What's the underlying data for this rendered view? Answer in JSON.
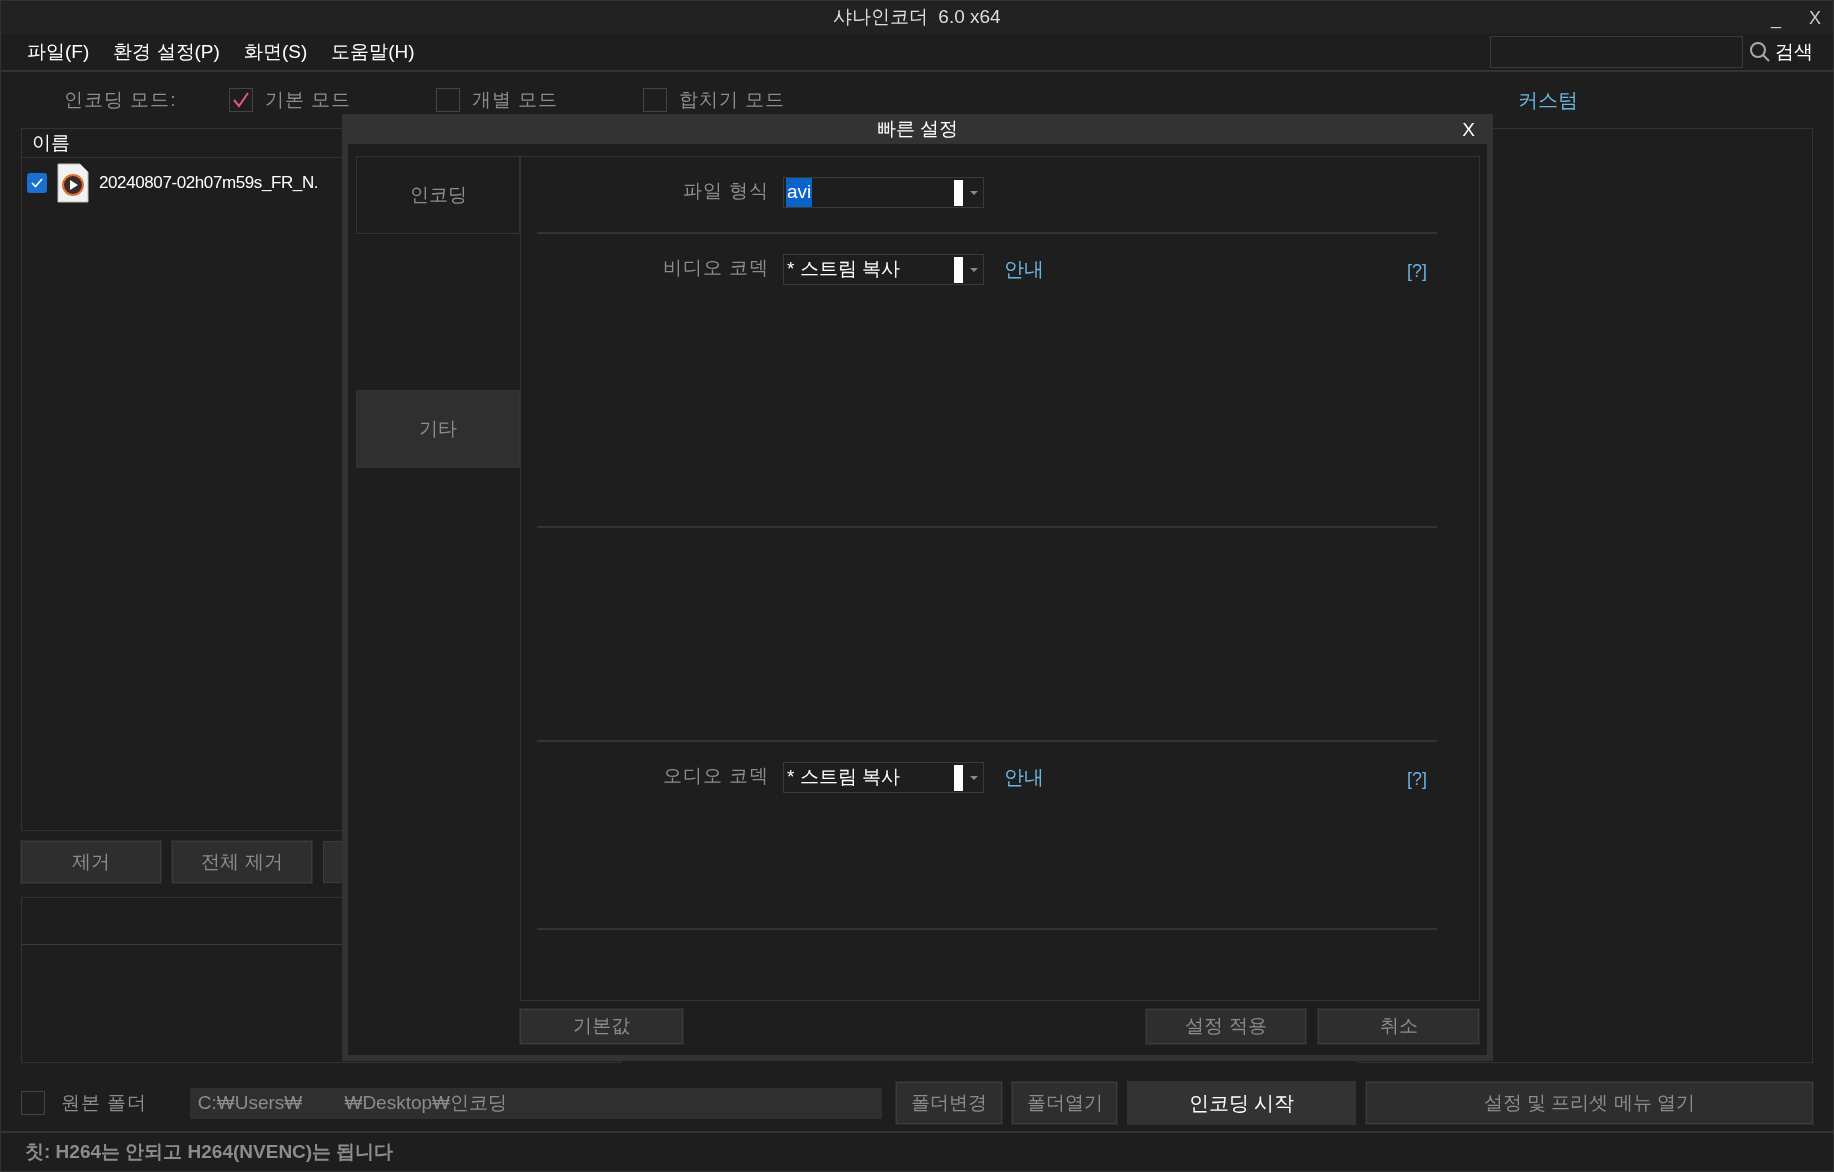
{
  "window": {
    "title": "샤나인코더",
    "version": "6.0 x64",
    "minimize": "_",
    "close": "X"
  },
  "menu": [
    "파일(F)",
    "환경 설정(P)",
    "화면(S)",
    "도움말(H)"
  ],
  "search": {
    "button": "검색"
  },
  "encoding_mode": {
    "label": "인코딩 모드:",
    "options": [
      {
        "label": "기본 모드",
        "checked": true
      },
      {
        "label": "개별 모드",
        "checked": false
      },
      {
        "label": "합치기 모드",
        "checked": false
      }
    ]
  },
  "custom_link": "커스텀",
  "file_list": {
    "column": "이름",
    "rows": [
      {
        "name": "20240807-02h07m59s_FR_N.",
        "checked": true
      }
    ]
  },
  "list_buttons": [
    "제거",
    "전체 제거"
  ],
  "output": {
    "source_folder": {
      "label": "원본 폴더",
      "checked": false
    },
    "path": "C:₩Users₩        ₩Desktop₩인코딩",
    "buttons": [
      "폴더변경",
      "폴더열기"
    ],
    "start": "인코딩 시작",
    "preset_menu": "설정 및 프리셋 메뉴 열기"
  },
  "status": "칫: H264는 안되고 H264(NVENC)는 됩니다",
  "dialog": {
    "title": "빠른 설정",
    "close": "X",
    "tabs": [
      {
        "label": "인코딩",
        "selected": false
      },
      {
        "label": "기타",
        "selected": true
      }
    ],
    "fields": [
      {
        "label": "파일 형식",
        "value": "avi",
        "highlighted": true
      },
      {
        "label": "비디오 코덱",
        "value": "* 스트림 복사",
        "highlighted": false,
        "guide": "안내",
        "help": "[?]"
      },
      {
        "label": "오디오 코덱",
        "value": "* 스트림 복사",
        "highlighted": false,
        "guide": "안내",
        "help": "[?]"
      }
    ],
    "default_button": "기본값",
    "apply_button": "설정 적용",
    "cancel_button": "취소"
  }
}
